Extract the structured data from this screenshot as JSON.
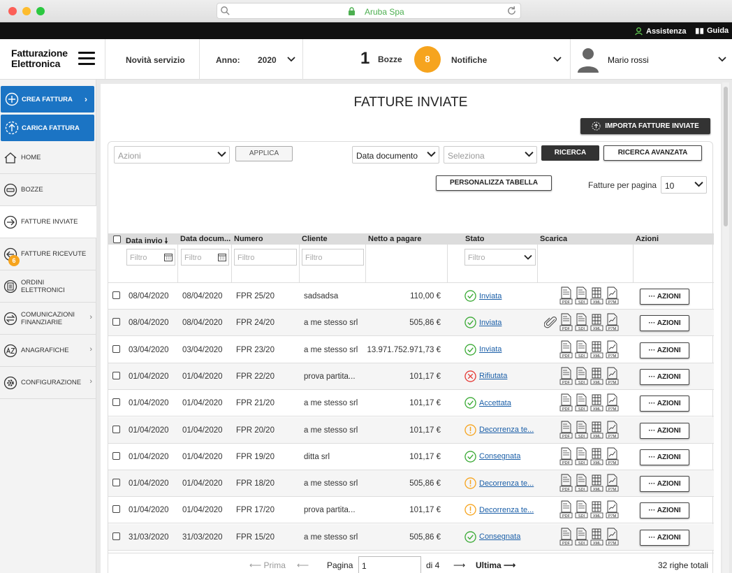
{
  "browser": {
    "url": "Aruba Spa"
  },
  "topbar": {
    "assistenza": "Assistenza",
    "guida": "Guida"
  },
  "header": {
    "logo_line1": "Fatturazione",
    "logo_line2": "Elettronica",
    "novita": "Novità servizio",
    "anno_label": "Anno:",
    "anno_value": "2020",
    "bozze_count": "1",
    "bozze_label": "Bozze",
    "notifiche_count": "8",
    "notifiche_label": "Notifiche",
    "user_name": "Mario rossi"
  },
  "sidebar": {
    "crea": "CREA FATTURA",
    "carica": "CARICA FATTURA",
    "items": [
      {
        "label": "HOME"
      },
      {
        "label": "BOZZE"
      },
      {
        "label": "FATTURE INVIATE"
      },
      {
        "label": "FATTURE RICEVUTE",
        "badge": "6"
      },
      {
        "label1": "ORDINI",
        "label2": "ELETTRONICI"
      },
      {
        "label1": "COMUNICAZIONI",
        "label2": "FINANZIARIE"
      },
      {
        "label": "ANAGRAFICHE"
      },
      {
        "label": "CONFIGURAZIONE"
      }
    ]
  },
  "main": {
    "title": "FATTURE INVIATE",
    "import_btn": "IMPORTA FATTURE INVIATE",
    "azioni_placeholder": "Azioni",
    "applica": "APPLICA",
    "data_documento": "Data documento",
    "seleziona_placeholder": "Seleziona",
    "ricerca": "RICERCA",
    "ricerca_avanzata": "RICERCA AVANZATA",
    "personalizza": "PERSONALIZZA TABELLA",
    "per_pagina_label": "Fatture per pagina",
    "per_pagina_value": "10"
  },
  "table": {
    "headers": [
      "Data invio",
      "Data docum...",
      "Numero",
      "Cliente",
      "Netto a pagare",
      "Stato",
      "Scarica",
      "Azioni"
    ],
    "filter_placeholder": "Filtro",
    "action_label": "AZIONI",
    "file_labels": [
      "PDF",
      "SDI",
      "XML",
      "P7M"
    ],
    "rows": [
      {
        "invio": "08/04/2020",
        "doc": "08/04/2020",
        "numero": "FPR 25/20",
        "cliente": "sadsadsa",
        "netto": "110,00 €",
        "stato": "Inviata",
        "status_type": "ok",
        "attach": false
      },
      {
        "invio": "08/04/2020",
        "doc": "08/04/2020",
        "numero": "FPR 24/20",
        "cliente": "a me stesso srl",
        "netto": "505,86 €",
        "stato": "Inviata",
        "status_type": "ok",
        "attach": true
      },
      {
        "invio": "03/04/2020",
        "doc": "03/04/2020",
        "numero": "FPR 23/20",
        "cliente": "a me stesso srl",
        "netto": "13.971.752.971,73 €",
        "stato": "Inviata",
        "status_type": "ok",
        "attach": false
      },
      {
        "invio": "01/04/2020",
        "doc": "01/04/2020",
        "numero": "FPR 22/20",
        "cliente": "prova partita...",
        "netto": "101,17 €",
        "stato": "Rifiutata",
        "status_type": "err",
        "attach": false
      },
      {
        "invio": "01/04/2020",
        "doc": "01/04/2020",
        "numero": "FPR 21/20",
        "cliente": "a me stesso srl",
        "netto": "101,17 €",
        "stato": "Accettata",
        "status_type": "ok",
        "attach": false
      },
      {
        "invio": "01/04/2020",
        "doc": "01/04/2020",
        "numero": "FPR 20/20",
        "cliente": "a me stesso srl",
        "netto": "101,17 €",
        "stato": "Decorrenza te...",
        "status_type": "warn",
        "attach": false
      },
      {
        "invio": "01/04/2020",
        "doc": "01/04/2020",
        "numero": "FPR 19/20",
        "cliente": "ditta srl",
        "netto": "101,17 €",
        "stato": "Consegnata",
        "status_type": "ok",
        "attach": false
      },
      {
        "invio": "01/04/2020",
        "doc": "01/04/2020",
        "numero": "FPR 18/20",
        "cliente": "a me stesso srl",
        "netto": "505,86 €",
        "stato": "Decorrenza te...",
        "status_type": "warn",
        "attach": false
      },
      {
        "invio": "01/04/2020",
        "doc": "01/04/2020",
        "numero": "FPR 17/20",
        "cliente": "prova partita...",
        "netto": "101,17 €",
        "stato": "Decorrenza te...",
        "status_type": "warn",
        "attach": false
      },
      {
        "invio": "31/03/2020",
        "doc": "31/03/2020",
        "numero": "FPR 15/20",
        "cliente": "a me stesso srl",
        "netto": "505,86 €",
        "stato": "Consegnata",
        "status_type": "ok",
        "attach": false
      }
    ]
  },
  "pager": {
    "prima": "Prima",
    "pagina_label": "Pagina",
    "pagina_value": "1",
    "di": "di 4",
    "ultima": "Ultima",
    "totale": "32 righe totali"
  },
  "colors": {
    "accent": "#1b74c4",
    "badge": "#f6a41e",
    "ok": "#3aaa35",
    "err": "#e53935",
    "warn": "#f6a41e",
    "link": "#1b5fa8"
  }
}
